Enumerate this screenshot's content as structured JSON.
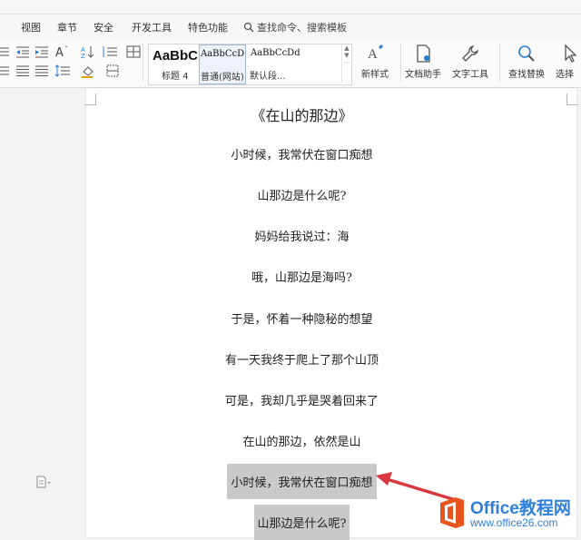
{
  "tabs": [
    "视图",
    "章节",
    "安全",
    "开发工具",
    "特色功能"
  ],
  "search": {
    "label": "查找命令、搜索模板"
  },
  "styles": [
    {
      "sample": "AaBbC",
      "caption": "标题 4"
    },
    {
      "sample": "AaBbCcD",
      "caption": "普通(网站)"
    },
    {
      "sample": "AaBbCcDd",
      "caption": "默认段..."
    }
  ],
  "ribbon_buttons": {
    "new_style": "新样式",
    "doc_assistant": "文档助手",
    "text_tools": "文字工具",
    "find_replace": "查找替换",
    "select": "选择"
  },
  "document": {
    "title": "《在山的那边》",
    "lines": [
      "小时候，我常伏在窗口痴想",
      "山那边是什么呢?",
      "妈妈给我说过：海",
      "哦，山那边是海吗?",
      "于是，怀着一种隐秘的想望",
      "有一天我终于爬上了那个山顶",
      "可是，我却几乎是哭着回来了",
      "在山的那边，依然是山"
    ],
    "highlighted_lines": [
      "小时候，我常伏在窗口痴想",
      "山那边是什么呢?"
    ]
  },
  "watermark": {
    "title": "Office教程网",
    "url": "www.office26.com"
  },
  "colors": {
    "highlight": "#c9c9c9",
    "arrow": "#d9363e",
    "watermark": "#2f7fd9",
    "logo": "#e8541e"
  }
}
